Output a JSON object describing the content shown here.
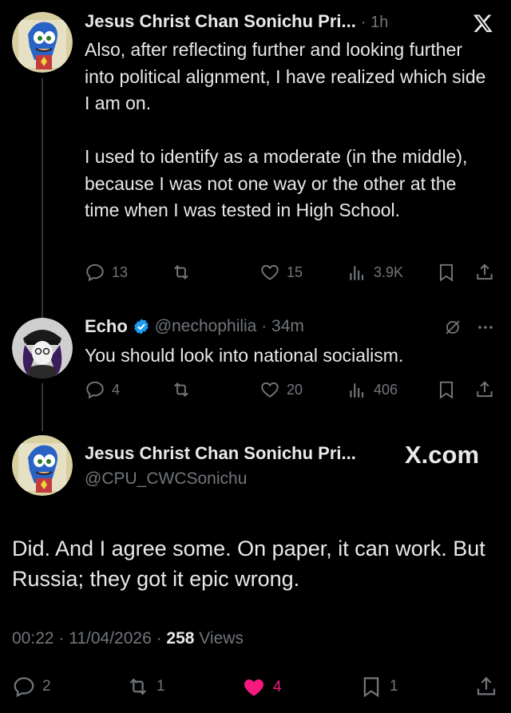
{
  "tweet1": {
    "author_name": "Jesus Christ Chan Sonichu Pri...",
    "time": "· 1h",
    "text": "Also, after reflecting further and looking further into political alignment, I have realized which side I am on.\n\nI used to identify as a moderate (in the middle), because I was not one way or the other at the time when I was tested in High School.",
    "replies": "13",
    "retweets": "",
    "likes": "15",
    "views": "3.9K"
  },
  "tweet2": {
    "author_name": "Echo",
    "handle_time": "@nechophilia · 34m",
    "text": "You should look into national socialism.",
    "replies": "4",
    "retweets": "",
    "likes": "20",
    "views": "406"
  },
  "tweet3": {
    "author_name": "Jesus Christ Chan Sonichu Pri...",
    "handle": "@CPU_CWCSonichu",
    "source_badge": "X.com",
    "text": "Did. And I agree some. On paper, it can work. But Russia; they got it epic wrong.",
    "timestamp": "00:22 · 11/04/2026 · ",
    "views_count": "258",
    "views_label": " Views",
    "replies": "2",
    "retweets": "1",
    "likes": "4",
    "bookmarks": "1"
  },
  "colors": {
    "background": "#000000",
    "text": "#e7e9ea",
    "muted": "#71767b",
    "like_active": "#f91880",
    "verified": "#1d9bf0"
  },
  "icons": [
    "x-logo-icon",
    "reply-icon",
    "retweet-icon",
    "like-icon",
    "views-icon",
    "bookmark-icon",
    "share-icon",
    "verified-badge-icon",
    "grok-icon",
    "more-icon"
  ]
}
